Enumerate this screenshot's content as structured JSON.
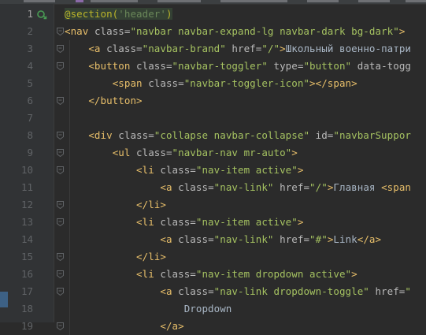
{
  "editor": {
    "language": "blade-html",
    "current_line": 1,
    "lines": [
      {
        "n": "1",
        "tokens": [
          [
            "ann",
            "@section("
          ],
          [
            "str",
            "'header'"
          ],
          [
            "ann",
            ")"
          ]
        ]
      },
      {
        "n": "2",
        "tokens": [
          [
            "tag",
            "<nav "
          ],
          [
            "attr",
            "class="
          ],
          [
            "aval",
            "\"navbar navbar-expand-lg navbar-dark bg-dark\""
          ],
          [
            "tag",
            ">"
          ]
        ]
      },
      {
        "n": "3",
        "tokens": [
          [
            "txt",
            "    "
          ],
          [
            "tag",
            "<a "
          ],
          [
            "attr",
            "class="
          ],
          [
            "aval",
            "\"navbar-brand\" "
          ],
          [
            "attr",
            "href="
          ],
          [
            "aval",
            "\"/\""
          ],
          [
            "tag",
            ">"
          ],
          [
            "txt",
            "Школьный военно-патри"
          ]
        ]
      },
      {
        "n": "4",
        "tokens": [
          [
            "txt",
            "    "
          ],
          [
            "tag",
            "<button "
          ],
          [
            "attr",
            "class="
          ],
          [
            "aval",
            "\"navbar-toggler\" "
          ],
          [
            "attr",
            "type="
          ],
          [
            "aval",
            "\"button\" "
          ],
          [
            "attr",
            "data-togg"
          ]
        ]
      },
      {
        "n": "5",
        "tokens": [
          [
            "txt",
            "        "
          ],
          [
            "tag",
            "<span "
          ],
          [
            "attr",
            "class="
          ],
          [
            "aval",
            "\"navbar-toggler-icon\""
          ],
          [
            "tag",
            "></span>"
          ]
        ]
      },
      {
        "n": "6",
        "tokens": [
          [
            "txt",
            "    "
          ],
          [
            "tag",
            "</button>"
          ]
        ]
      },
      {
        "n": "7",
        "tokens": []
      },
      {
        "n": "8",
        "tokens": [
          [
            "txt",
            "    "
          ],
          [
            "tag",
            "<div "
          ],
          [
            "attr",
            "class="
          ],
          [
            "aval",
            "\"collapse navbar-collapse\" "
          ],
          [
            "attr",
            "id="
          ],
          [
            "aval",
            "\"navbarSuppor"
          ]
        ]
      },
      {
        "n": "9",
        "tokens": [
          [
            "txt",
            "        "
          ],
          [
            "tag",
            "<ul "
          ],
          [
            "attr",
            "class="
          ],
          [
            "aval",
            "\"navbar-nav mr-auto\""
          ],
          [
            "tag",
            ">"
          ]
        ]
      },
      {
        "n": "10",
        "tokens": [
          [
            "txt",
            "            "
          ],
          [
            "tag",
            "<li "
          ],
          [
            "attr",
            "class="
          ],
          [
            "aval",
            "\"nav-item active\""
          ],
          [
            "tag",
            ">"
          ]
        ]
      },
      {
        "n": "11",
        "tokens": [
          [
            "txt",
            "                "
          ],
          [
            "tag",
            "<a "
          ],
          [
            "attr",
            "class="
          ],
          [
            "aval",
            "\"nav-link\" "
          ],
          [
            "attr",
            "href="
          ],
          [
            "aval",
            "\"/\""
          ],
          [
            "tag",
            ">"
          ],
          [
            "txt",
            "Главная "
          ],
          [
            "tag",
            "<span"
          ]
        ]
      },
      {
        "n": "12",
        "tokens": [
          [
            "txt",
            "            "
          ],
          [
            "tag",
            "</li>"
          ]
        ]
      },
      {
        "n": "13",
        "tokens": [
          [
            "txt",
            "            "
          ],
          [
            "tag",
            "<li "
          ],
          [
            "attr",
            "class="
          ],
          [
            "aval",
            "\"nav-item active\""
          ],
          [
            "tag",
            ">"
          ]
        ]
      },
      {
        "n": "14",
        "tokens": [
          [
            "txt",
            "                "
          ],
          [
            "tag",
            "<a "
          ],
          [
            "attr",
            "class="
          ],
          [
            "aval",
            "\"nav-link\" "
          ],
          [
            "attr",
            "href="
          ],
          [
            "aval",
            "\"#\""
          ],
          [
            "tag",
            ">"
          ],
          [
            "txt",
            "Link"
          ],
          [
            "tag",
            "</a>"
          ]
        ]
      },
      {
        "n": "15",
        "tokens": [
          [
            "txt",
            "            "
          ],
          [
            "tag",
            "</li>"
          ]
        ]
      },
      {
        "n": "16",
        "tokens": [
          [
            "txt",
            "            "
          ],
          [
            "tag",
            "<li "
          ],
          [
            "attr",
            "class="
          ],
          [
            "aval",
            "\"nav-item dropdown active\""
          ],
          [
            "tag",
            ">"
          ]
        ]
      },
      {
        "n": "17",
        "tokens": [
          [
            "txt",
            "                "
          ],
          [
            "tag",
            "<a "
          ],
          [
            "attr",
            "class="
          ],
          [
            "aval",
            "\"nav-link dropdown-toggle\" "
          ],
          [
            "attr",
            "href="
          ],
          [
            "aval",
            "\""
          ]
        ]
      },
      {
        "n": "18",
        "tokens": [
          [
            "txt",
            "                    Dropdown"
          ]
        ]
      },
      {
        "n": "19",
        "tokens": [
          [
            "txt",
            "                "
          ],
          [
            "tag",
            "</a>"
          ]
        ]
      }
    ]
  },
  "gutter": {
    "fold_lines": [
      "2",
      "3",
      "4",
      "6",
      "8",
      "9",
      "10",
      "12",
      "13",
      "15",
      "16",
      "17",
      "19"
    ],
    "icon": "override-method-icon"
  },
  "colors": {
    "background": "#2b2b2b",
    "annotation": "#bbb529",
    "string": "#6a8759",
    "tag": "#e8bf6a",
    "attribute": "#bababa",
    "attribute_value": "#a5c261",
    "text": "#a9b7c6"
  }
}
